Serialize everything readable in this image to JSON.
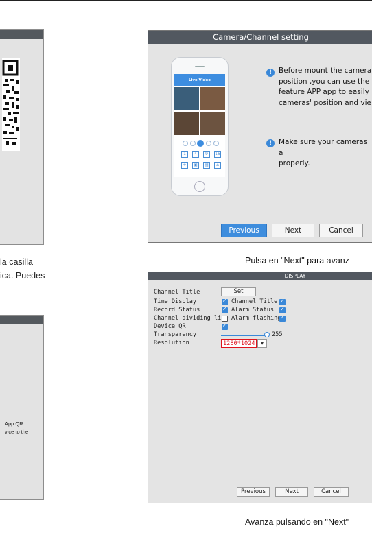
{
  "left": {
    "caption1_line1": "la casilla",
    "caption1_line2": "ica. Puedes",
    "panel2_line1": "App QR",
    "panel2_line2": "vice to the"
  },
  "camera_setting": {
    "title": "Camera/Channel setting",
    "phone_header": "Live Video",
    "info1_lines": [
      "Before mount the camera",
      "position ,you can use the",
      "feature APP app to easily",
      "cameras' position and vie"
    ],
    "info2_lines": [
      "Make sure your cameras a",
      "properly."
    ],
    "buttons": {
      "previous": "Previous",
      "next": "Next",
      "cancel": "Cancel"
    },
    "caption": "Pulsa en \"Next\" para avanz"
  },
  "display": {
    "title": "DISPLAY",
    "rows": {
      "channel_title": "Channel Title",
      "set": "Set",
      "time_display": "Time Display",
      "channel_title_right": "Channel Title",
      "record_status": "Record Status",
      "alarm_status": "Alarm Status",
      "channel_dividing_line": "Channel dividing line",
      "alarm_flashing": "Alarm flashing",
      "device_qr": "Device QR",
      "transparency": "Transparency",
      "transparency_value": "255",
      "resolution": "Resolution",
      "resolution_value": "1280*1024"
    },
    "checkboxes": {
      "time_display": true,
      "channel_title": true,
      "record_status": true,
      "alarm_status": true,
      "channel_dividing_line": false,
      "alarm_flashing": true,
      "device_qr": true
    },
    "buttons": {
      "previous": "Previous",
      "next": "Next",
      "cancel": "Cancel"
    },
    "caption": "Avanza pulsando en \"Next\""
  },
  "colors": {
    "titlebar": "#525860",
    "accent": "#3a88d8",
    "resolution_text": "#e0141e"
  }
}
